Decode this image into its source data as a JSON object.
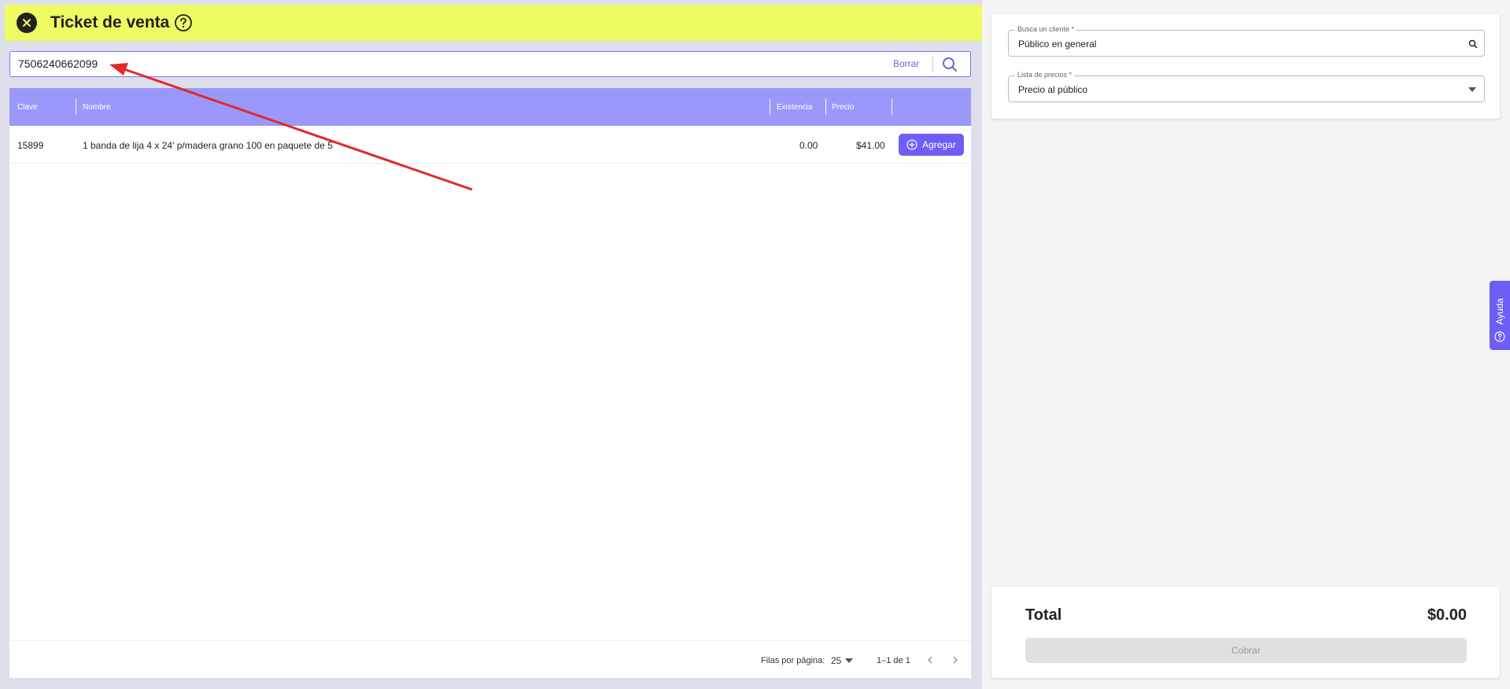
{
  "header": {
    "title": "Ticket de venta"
  },
  "search": {
    "value": "7506240662099",
    "clear_label": "Borrar"
  },
  "table": {
    "columns": {
      "key": "Clave",
      "name": "Nombre",
      "stock": "Existencia",
      "price": "Precio"
    },
    "rows": [
      {
        "key": "15899",
        "name": "1 banda de lija 4 x 24' p/madera grano 100 en paquete de 5",
        "stock": "0.00",
        "price": "$41.00",
        "action": "Agregar"
      }
    ],
    "footer": {
      "rows_per_page_label": "Filas por página:",
      "rows_per_page": "25",
      "range": "1–1 de 1"
    }
  },
  "customer": {
    "label": "Busca un cliente *",
    "value": "Público en general"
  },
  "price_list": {
    "label": "Lista de precios *",
    "value": "Precio al público"
  },
  "totals": {
    "label": "Total",
    "value": "$0.00",
    "charge_label": "Cobrar"
  },
  "help_tab": {
    "label": "Ayuda"
  },
  "colors": {
    "header_bg": "#eefb62",
    "accent": "#6d5ef5",
    "table_header": "#9a98fb",
    "annotation": "#e02a2a"
  }
}
